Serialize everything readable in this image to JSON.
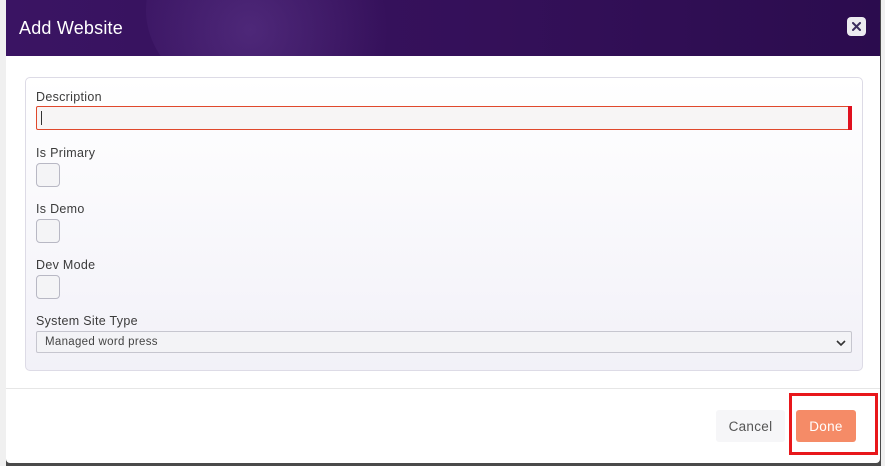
{
  "modal": {
    "title": "Add Website",
    "close_icon": "close-icon"
  },
  "form": {
    "description": {
      "label": "Description",
      "value": "",
      "placeholder": ""
    },
    "is_primary": {
      "label": "Is Primary",
      "checked": false
    },
    "is_demo": {
      "label": "Is Demo",
      "checked": false
    },
    "dev_mode": {
      "label": "Dev Mode",
      "checked": false
    },
    "system_site_type": {
      "label": "System Site Type",
      "selected": "Managed word press",
      "icon": "chevron-down-icon"
    }
  },
  "footer": {
    "cancel_label": "Cancel",
    "done_label": "Done"
  },
  "colors": {
    "header": "#341059",
    "accent": "#f58b67",
    "error_border": "#e0482c",
    "highlight": "#e8171b"
  }
}
